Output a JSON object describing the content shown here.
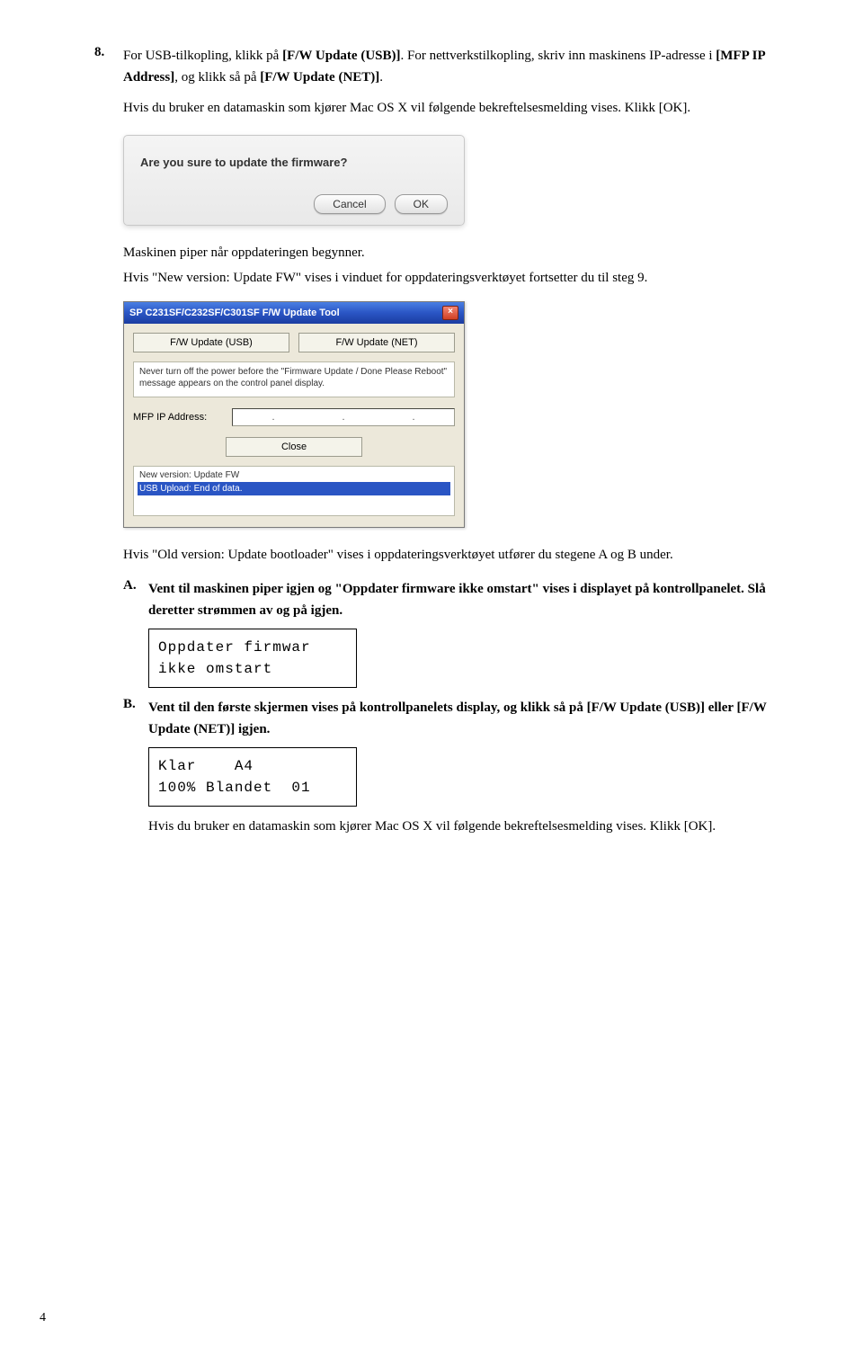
{
  "step8": {
    "num": "8.",
    "text_pre": "For USB-tilkopling, klikk på ",
    "btn_usb": "[F/W Update (USB)]",
    "text_mid": ". For nettverkstilkopling, skriv inn maskinens IP-adresse i ",
    "ip_label": "[MFP IP Address]",
    "text_mid2": ", og klikk så på ",
    "btn_net": "[F/W Update (NET)]",
    "text_post": ".",
    "mac_note_pre": "Hvis du bruker en datamaskin som kjører Mac OS X vil følgende bekreftelsesmelding vises. Klikk ",
    "ok_label": "[OK]",
    "mac_note_post": "."
  },
  "mac_dialog": {
    "text": "Are you sure to update the firmware?",
    "cancel": "Cancel",
    "ok": "OK"
  },
  "after_dialog1": "Maskinen piper når oppdateringen begynner.",
  "after_dialog2": "Hvis \"New version: Update FW\" vises i vinduet for oppdateringsverktøyet fortsetter du til steg 9.",
  "win": {
    "title": "SP C231SF/C232SF/C301SF F/W Update Tool",
    "btn_usb": "F/W Update (USB)",
    "btn_net": "F/W Update (NET)",
    "warn": "Never turn off the power before the \"Firmware Update / Done Please Reboot\" message appears on the control panel display.",
    "ip_label": "MFP IP Address:",
    "close": "Close",
    "status1": "New version: Update FW",
    "status2": "USB Upload: End of data."
  },
  "after_win": "Hvis \"Old version: Update bootloader\" vises i oppdateringsverktøyet utfører du stegene A og B under.",
  "stepA": {
    "letter": "A.",
    "text1": "Vent til maskinen piper igjen og \"Oppdater firmware ikke omstart\" vises i displayet på kontrollpanelet. Slå deretter strømmen av og på igjen.",
    "lcd1": "Oppdater firmwar",
    "lcd2": "ikke omstart"
  },
  "stepB": {
    "letter": "B.",
    "text_pre": "Vent til den første skjermen vises på kontrollpanelets display, og klikk så på ",
    "usb": "[F/W Update (USB)]",
    "mid": " eller ",
    "net": "[F/W Update (NET)]",
    "post": " igjen.",
    "lcd1": "Klar    A4",
    "lcd2": "100% Blandet  01",
    "mac_note_pre": "Hvis du bruker en datamaskin som kjører Mac OS X vil følgende bekreftelsesmelding vises. Klikk ",
    "ok_label": "[OK]",
    "mac_note_post": "."
  },
  "page_number": "4"
}
